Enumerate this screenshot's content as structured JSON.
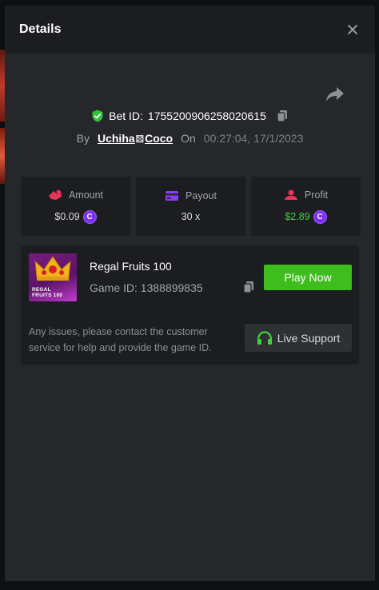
{
  "modal": {
    "title": "Details"
  },
  "bet": {
    "label": "Bet ID:",
    "id": "1755200906258020615"
  },
  "byline": {
    "by": "By",
    "user_part1": "Uchiha",
    "user_part2": "Coco",
    "on": "On",
    "datetime": "00:27:04, 17/1/2023"
  },
  "stats": [
    {
      "label": "Amount",
      "value": "$0.09",
      "icon": "chip-icon"
    },
    {
      "label": "Payout",
      "value": "30 x",
      "icon": "card-icon"
    },
    {
      "label": "Profit",
      "value": "$2.89",
      "icon": "profit-icon"
    }
  ],
  "game": {
    "name": "Regal Fruits 100",
    "id_label": "Game ID:",
    "id": "1388899835",
    "thumb_line1": "REGAL",
    "thumb_line2": "FRUITS 100",
    "play_label": "Play Now"
  },
  "support": {
    "message": "Any issues, please contact the customer service for help and provide the game ID.",
    "button_label": "Live Support"
  },
  "colors": {
    "accent_green": "#3fbd1f",
    "profit_green": "#3fd33b",
    "coin_purple": "#7b2ff7",
    "modal_bg": "#25272b"
  }
}
